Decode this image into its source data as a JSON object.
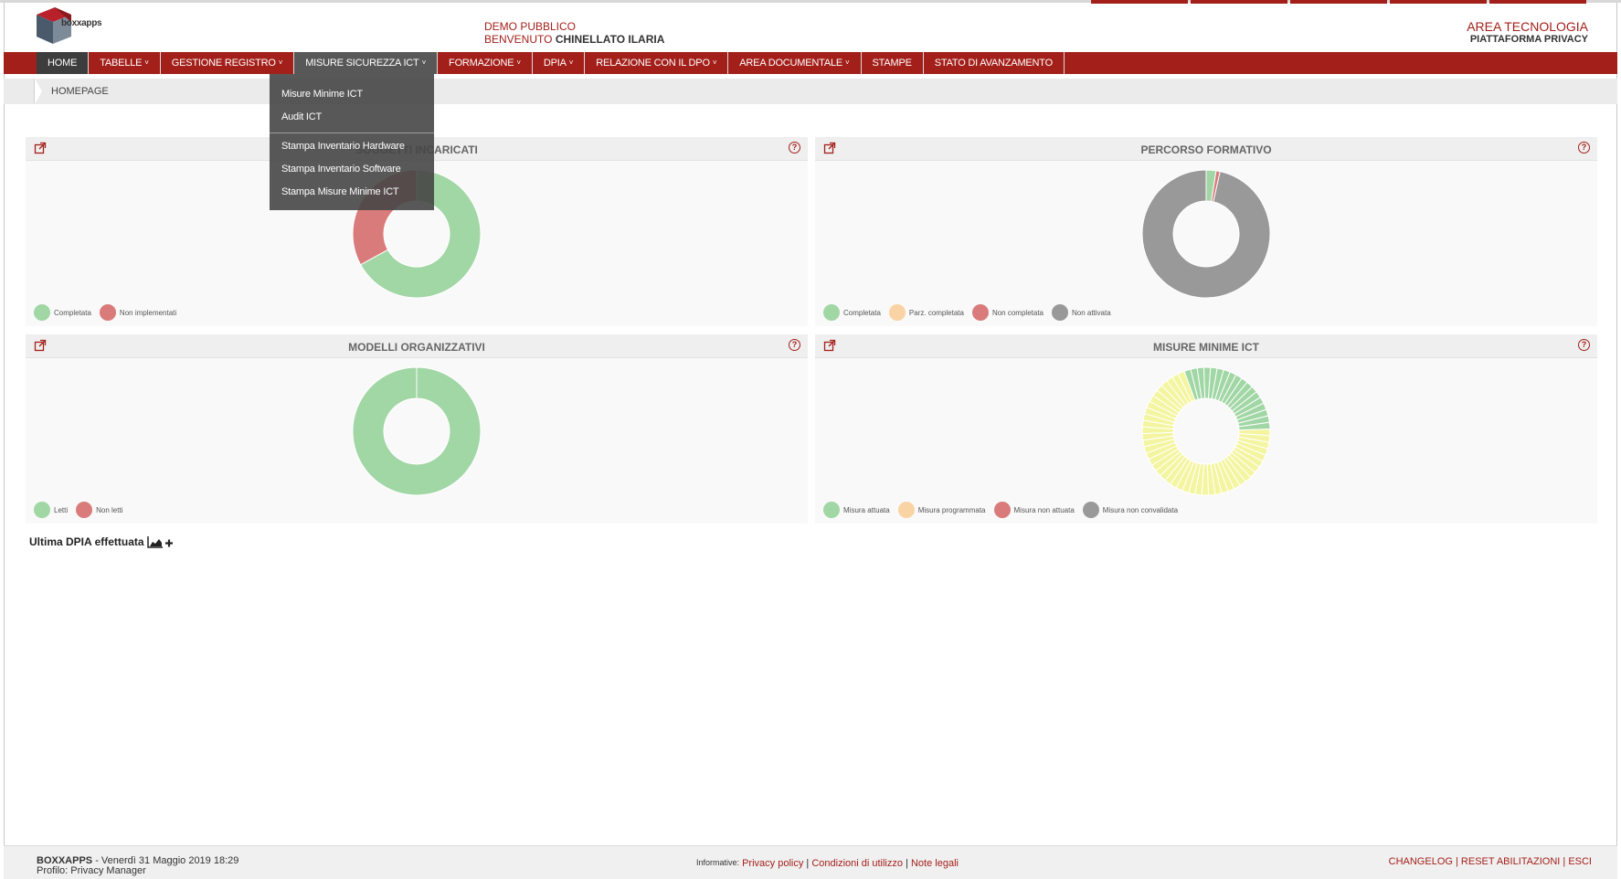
{
  "header": {
    "logo_text": "boxxapps",
    "org": "DEMO PUBBLICO",
    "welcome_prefix": "BENVENUTO",
    "user_name": "CHINELLATO ILARIA",
    "area": "AREA TECNOLOGIA",
    "platform": "PIATTAFORMA PRIVACY"
  },
  "nav": {
    "items": [
      {
        "label": "HOME",
        "dropdown": false
      },
      {
        "label": "TABELLE",
        "dropdown": true
      },
      {
        "label": "GESTIONE REGISTRO",
        "dropdown": true
      },
      {
        "label": "MISURE SICUREZZA ICT",
        "dropdown": true
      },
      {
        "label": "FORMAZIONE",
        "dropdown": true
      },
      {
        "label": "DPIA",
        "dropdown": true
      },
      {
        "label": "RELAZIONE CON IL DPO",
        "dropdown": true
      },
      {
        "label": "AREA DOCUMENTALE",
        "dropdown": true
      },
      {
        "label": "STAMPE",
        "dropdown": false
      },
      {
        "label": "STATO DI AVANZAMENTO",
        "dropdown": false
      }
    ],
    "open_menu": {
      "items": [
        "Misure Minime ICT",
        "Audit ICT",
        "Stampa Inventario Hardware",
        "Stampa Inventario Software",
        "Stampa Misure Minime ICT"
      ]
    }
  },
  "breadcrumb": {
    "current": "HOMEPAGE"
  },
  "colors": {
    "brand": "#a31f1a",
    "green": "#a1d6a5",
    "red": "#d97b7b",
    "grey": "#999999",
    "orange": "#f9d3a3",
    "yellow": "#f4f5a0"
  },
  "widgets": {
    "soggetti": {
      "title": "SOGGETTI INCARICATI",
      "help": "?",
      "legend": [
        {
          "label": "Completata",
          "color": "#a1d6a5"
        },
        {
          "label": "Non implementati",
          "color": "#d97b7b"
        }
      ]
    },
    "percorso": {
      "title": "PERCORSO FORMATIVO",
      "help": "?",
      "legend": [
        {
          "label": "Completata",
          "color": "#a1d6a5"
        },
        {
          "label": "Parz. completata",
          "color": "#f9d3a3"
        },
        {
          "label": "Non completata",
          "color": "#d97b7b"
        },
        {
          "label": "Non attivata",
          "color": "#999999"
        }
      ]
    },
    "modelli": {
      "title": "MODELLI ORGANIZZATIVI",
      "help": "?",
      "legend": [
        {
          "label": "Letti",
          "color": "#a1d6a5"
        },
        {
          "label": "Non letti",
          "color": "#d97b7b"
        }
      ]
    },
    "misure": {
      "title": "MISURE MINIME ICT",
      "help": "?",
      "legend": [
        {
          "label": "Misura attuata",
          "color": "#a1d6a5"
        },
        {
          "label": "Misura programmata",
          "color": "#f9d3a3"
        },
        {
          "label": "Misura non attuata",
          "color": "#d97b7b"
        },
        {
          "label": "Misura non convalidata",
          "color": "#999999"
        }
      ]
    }
  },
  "chart_data": [
    {
      "type": "pie",
      "title": "SOGGETTI INCARICATI",
      "categories": [
        "Completata",
        "Non implementati"
      ],
      "values": [
        67,
        33
      ]
    },
    {
      "type": "pie",
      "title": "PERCORSO FORMATIVO",
      "categories": [
        "Completata",
        "Parz. completata",
        "Non completata",
        "Non attivata"
      ],
      "values": [
        2.5,
        0,
        1,
        96.5
      ]
    },
    {
      "type": "pie",
      "title": "MODELLI ORGANIZZATIVI",
      "categories": [
        "Letti",
        "Non letti"
      ],
      "values": [
        100,
        0
      ]
    },
    {
      "type": "pie",
      "title": "MISURE MINIME ICT",
      "categories": [
        "Misura attuata",
        "Misura programmata",
        "Misura non attuata",
        "Misura non convalidata"
      ],
      "values": [
        30,
        70,
        0,
        0
      ]
    }
  ],
  "dpia": {
    "label": "Ultima DPIA effettuata"
  },
  "footer": {
    "brand": "BOXXAPPS",
    "datetime": "- Venerdì 31 Maggio 2019 18:29",
    "profile": "Profilo: Privacy Manager",
    "informative_label": "Informative:",
    "privacy": "Privacy policy",
    "conditions": "Condizioni di utilizzo",
    "legal": "Note legali",
    "sep": "|",
    "changelog": "CHANGELOG",
    "reset": "RESET ABILITAZIONI",
    "exit": "ESCI"
  }
}
